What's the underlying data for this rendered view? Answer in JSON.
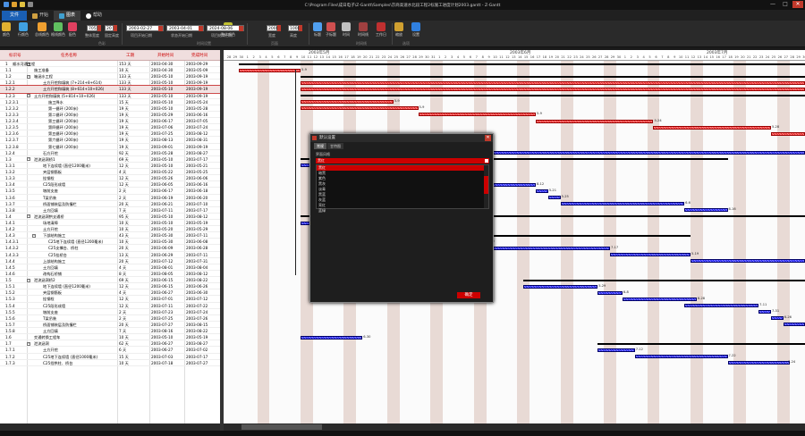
{
  "window": {
    "title": "C:\\Program Files\\成日电子\\Z-Gantt\\Samples\\京商高速水北段工程2标施工进度计划2003.gantt - Z-Gantt",
    "controls": {
      "minimize": "—",
      "maximize": "□",
      "close": "✕"
    }
  },
  "tabs": {
    "file": "文件",
    "start": "开始",
    "view": "图表",
    "help": "帮助"
  },
  "ribbon": {
    "buttons": [
      {
        "label": "颜色",
        "color": "#e0b030"
      },
      {
        "label": "行颜色",
        "color": "#40a0e0"
      },
      {
        "label": "总线颜色",
        "color": "#f0a030"
      },
      {
        "label": "格线颜色",
        "color": "#60c060"
      },
      {
        "label": "配色",
        "color": "#e04060"
      },
      {
        "label": "整体颜色",
        "color": "#c0c030"
      },
      {
        "label": "标题",
        "color": "#50a0f0"
      },
      {
        "label": "子标题",
        "color": "#d05050"
      },
      {
        "label": "时间",
        "color": "#c0c0c0"
      },
      {
        "label": "时间线",
        "color": "#a04040"
      },
      {
        "label": "工作日",
        "color": "#c03030"
      },
      {
        "label": "缩放",
        "color": "#d0a030"
      },
      {
        "label": "设置",
        "color": "#3080e0"
      }
    ],
    "zoom_value": "705",
    "zoom_label": "整体宽度",
    "row_height_value": "20",
    "row_height_label": "固定高度",
    "date_start": "2003-02-27",
    "date_start_label": "项目开始日期",
    "date_status": "2003-04-01",
    "date_status_label": "状态开始日期",
    "date_end": "2024-08-06",
    "date_end_label": "项目结束日期",
    "width_value": "2000",
    "width_label": "宽度",
    "height_value": "1000",
    "height_label": "高度",
    "groups": {
      "color": "色彩",
      "time": "时间设置",
      "page": "页面",
      "timeline": "时间线",
      "setup": "选项"
    }
  },
  "grid": {
    "headers": {
      "id": "标识号",
      "name": "任务名称",
      "duration": "工期",
      "start": "开始时间",
      "finish": "完成时间"
    },
    "rows": [
      {
        "id": "1",
        "indent": 0,
        "toggle": "−",
        "name": "顺水河通工程",
        "duration": "153 天",
        "start": "2003-04-30",
        "finish": "2003-09-29"
      },
      {
        "id": "1.1",
        "indent": 1,
        "name": "施工准备",
        "duration": "10 天",
        "start": "2003-04-30",
        "finish": "2003-05-09"
      },
      {
        "id": "1.2",
        "indent": 1,
        "toggle": "−",
        "name": "箱涵水工程",
        "duration": "133 天",
        "start": "2003-05-10",
        "finish": "2003-09-19"
      },
      {
        "id": "1.2.1",
        "indent": 2,
        "name": "土方开挖和填筑 (7+214+8+614)",
        "duration": "133 天",
        "start": "2003-05-10",
        "finish": "2003-09-19"
      },
      {
        "id": "1.2.2",
        "indent": 2,
        "name": "土方开挖和填筑 (8+614+10+026)",
        "duration": "133 天",
        "start": "2003-05-10",
        "finish": "2003-09-19",
        "selected": true
      },
      {
        "id": "1.2.3",
        "indent": 1,
        "toggle": "−",
        "name": "土方开挖和填筑 (5+814+10+026)",
        "duration": "133 天",
        "start": "2003-05-10",
        "finish": "2003-09-19"
      },
      {
        "id": "1.2.3.1",
        "indent": 3,
        "name": "施工降水",
        "duration": "15 天",
        "start": "2003-05-10",
        "finish": "2003-05-24"
      },
      {
        "id": "1.2.3.2",
        "indent": 3,
        "name": "第一循环 (200米)",
        "duration": "19 天",
        "start": "2003-05-10",
        "finish": "2003-05-28"
      },
      {
        "id": "1.2.3.3",
        "indent": 3,
        "name": "第二循环 (200米)",
        "duration": "19 天",
        "start": "2003-05-29",
        "finish": "2003-06-16"
      },
      {
        "id": "1.2.3.4",
        "indent": 3,
        "name": "第三循环 (200米)",
        "duration": "19 天",
        "start": "2003-06-17",
        "finish": "2003-07-05"
      },
      {
        "id": "1.2.3.5",
        "indent": 3,
        "name": "第四循环 (200米)",
        "duration": "19 天",
        "start": "2003-07-06",
        "finish": "2003-07-24"
      },
      {
        "id": "1.2.3.6",
        "indent": 3,
        "name": "第五循环 (200米)",
        "duration": "19 天",
        "start": "2003-07-25",
        "finish": "2003-08-12"
      },
      {
        "id": "1.2.3.7",
        "indent": 3,
        "name": "第六循环 (200米)",
        "duration": "19 天",
        "start": "2003-08-13",
        "finish": "2003-08-31"
      },
      {
        "id": "1.2.3.8",
        "indent": 3,
        "name": "第七循环 (200米)",
        "duration": "19 天",
        "start": "2003-09-01",
        "finish": "2003-09-19"
      },
      {
        "id": "1.2.4",
        "indent": 2,
        "name": "石方开挖",
        "duration": "92 天",
        "start": "2003-05-28",
        "finish": "2003-08-27"
      },
      {
        "id": "1.3",
        "indent": 1,
        "toggle": "−",
        "name": "泄流涵洞桥1",
        "duration": "69 天",
        "start": "2003-05-10",
        "finish": "2003-07-17"
      },
      {
        "id": "1.3.1",
        "indent": 2,
        "name": "地下连续墙 (直径1200毫米)",
        "duration": "12 天",
        "start": "2003-05-10",
        "finish": "2003-05-21"
      },
      {
        "id": "1.3.2",
        "indent": 2,
        "name": "夹层钢筋板",
        "duration": "4 天",
        "start": "2003-05-22",
        "finish": "2003-05-25"
      },
      {
        "id": "1.3.3",
        "indent": 2,
        "name": "挂钢栓",
        "duration": "12 天",
        "start": "2003-05-26",
        "finish": "2003-06-06"
      },
      {
        "id": "1.3.4",
        "indent": 2,
        "name": "C25段形成墙",
        "duration": "12 天",
        "start": "2003-06-05",
        "finish": "2003-06-16"
      },
      {
        "id": "1.3.5",
        "indent": 2,
        "name": "墩前支座",
        "duration": "2 天",
        "start": "2003-06-17",
        "finish": "2003-06-18"
      },
      {
        "id": "1.3.6",
        "indent": 2,
        "name": "T梁吊装",
        "duration": "2 天",
        "start": "2003-06-19",
        "finish": "2003-06-20"
      },
      {
        "id": "1.3.7",
        "indent": 2,
        "name": "桥面铺装层及防撞栏",
        "duration": "20 天",
        "start": "2003-06-21",
        "finish": "2003-07-10"
      },
      {
        "id": "1.3.8",
        "indent": 2,
        "name": "土方回填",
        "duration": "7 天",
        "start": "2003-07-11",
        "finish": "2003-07-17"
      },
      {
        "id": "1.4",
        "indent": 1,
        "toggle": "−",
        "name": "泄流涵洞拱支通桥",
        "duration": "95 天",
        "start": "2003-05-10",
        "finish": "2003-08-12"
      },
      {
        "id": "1.4.1",
        "indent": 2,
        "name": "场地清障",
        "duration": "10 天",
        "start": "2003-05-10",
        "finish": "2003-05-19"
      },
      {
        "id": "1.4.2",
        "indent": 2,
        "name": "土方开挖",
        "duration": "10 天",
        "start": "2003-05-20",
        "finish": "2003-05-29"
      },
      {
        "id": "1.4.3",
        "indent": 2,
        "toggle": "−",
        "name": "下部结构施工",
        "duration": "43 天",
        "start": "2003-05-30",
        "finish": "2003-07-11"
      },
      {
        "id": "1.4.3.1",
        "indent": 3,
        "name": "C25地下连续墙 (直径1200毫米)",
        "duration": "10 天",
        "start": "2003-05-30",
        "finish": "2003-06-08"
      },
      {
        "id": "1.4.3.2",
        "indent": 3,
        "name": "C25支撑台、桥柱",
        "duration": "20 天",
        "start": "2003-06-09",
        "finish": "2003-06-28"
      },
      {
        "id": "1.4.3.3",
        "indent": 3,
        "name": "C25挂桥台",
        "duration": "13 天",
        "start": "2003-06-29",
        "finish": "2003-07-11"
      },
      {
        "id": "1.4.4",
        "indent": 2,
        "name": "上部结构施工",
        "duration": "20 天",
        "start": "2003-07-12",
        "finish": "2003-07-31"
      },
      {
        "id": "1.4.5",
        "indent": 2,
        "name": "土方回填",
        "duration": "4 天",
        "start": "2003-08-01",
        "finish": "2003-08-04"
      },
      {
        "id": "1.4.6",
        "indent": 2,
        "name": "改构石桥铺",
        "duration": "8 天",
        "start": "2003-08-05",
        "finish": "2003-08-12"
      },
      {
        "id": "1.5",
        "indent": 1,
        "toggle": "−",
        "name": "泄流涵洞桥2",
        "duration": "69 天",
        "start": "2003-06-15",
        "finish": "2003-08-22"
      },
      {
        "id": "1.5.1",
        "indent": 2,
        "name": "地下连续墙 (直径1200毫米)",
        "duration": "12 天",
        "start": "2003-06-15",
        "finish": "2003-06-26"
      },
      {
        "id": "1.5.2",
        "indent": 2,
        "name": "夹层钢筋板",
        "duration": "4 天",
        "start": "2003-06-27",
        "finish": "2003-06-30"
      },
      {
        "id": "1.5.3",
        "indent": 2,
        "name": "挂钢栓",
        "duration": "12 天",
        "start": "2003-07-01",
        "finish": "2003-07-12"
      },
      {
        "id": "1.5.4",
        "indent": 2,
        "name": "C25段形成墙",
        "duration": "12 天",
        "start": "2003-07-11",
        "finish": "2003-07-22"
      },
      {
        "id": "1.5.5",
        "indent": 2,
        "name": "墩前支座",
        "duration": "2 天",
        "start": "2003-07-23",
        "finish": "2003-07-24"
      },
      {
        "id": "1.5.6",
        "indent": 2,
        "name": "T梁吊装",
        "duration": "2 天",
        "start": "2003-07-25",
        "finish": "2003-07-26"
      },
      {
        "id": "1.5.7",
        "indent": 2,
        "name": "桥面铺装层及防撞栏",
        "duration": "20 天",
        "start": "2003-07-27",
        "finish": "2003-08-15"
      },
      {
        "id": "1.5.8",
        "indent": 2,
        "name": "土方回填",
        "duration": "7 天",
        "start": "2003-08-16",
        "finish": "2003-08-22"
      },
      {
        "id": "1.6",
        "indent": 1,
        "name": "交通转换工程车",
        "duration": "10 天",
        "start": "2003-05-10",
        "finish": "2003-05-19"
      },
      {
        "id": "1.7",
        "indent": 1,
        "toggle": "−",
        "name": "泄流涵洞",
        "duration": "62 天",
        "start": "2003-06-27",
        "finish": "2003-08-27"
      },
      {
        "id": "1.7.1",
        "indent": 2,
        "name": "土方开挖",
        "duration": "6 天",
        "start": "2003-06-27",
        "finish": "2003-07-02"
      },
      {
        "id": "1.7.2",
        "indent": 2,
        "name": "C25地下连续墙 (直径1000毫米)",
        "duration": "15 天",
        "start": "2003-07-03",
        "finish": "2003-07-17"
      },
      {
        "id": "1.7.3",
        "indent": 2,
        "name": "C25挡拱柱、桥台",
        "duration": "10 天",
        "start": "2003-07-18",
        "finish": "2003-07-27"
      }
    ]
  },
  "gantt": {
    "months": [
      "2003年5月",
      "2003年6月",
      "2003年7月"
    ],
    "days": [
      "28",
      "29",
      "30",
      "1",
      "2",
      "3",
      "4",
      "5",
      "6",
      "7",
      "8",
      "9",
      "10",
      "11",
      "12",
      "13",
      "14",
      "15",
      "16",
      "17",
      "18",
      "19",
      "20",
      "21",
      "22",
      "23",
      "24",
      "25",
      "26",
      "27",
      "28",
      "29",
      "30",
      "31",
      "1",
      "2",
      "3",
      "4",
      "5",
      "6",
      "7",
      "8",
      "9",
      "10",
      "11",
      "12",
      "13",
      "14",
      "15",
      "16",
      "17",
      "18",
      "19",
      "20",
      "21",
      "22",
      "23",
      "24",
      "25",
      "26",
      "27",
      "28",
      "29",
      "30",
      "1",
      "2",
      "3",
      "4",
      "5",
      "6",
      "7",
      "8",
      "9",
      "10",
      "11",
      "12",
      "13",
      "14",
      "15",
      "16",
      "17",
      "18",
      "19",
      "20",
      "21",
      "22",
      "23",
      "24",
      "25",
      "26",
      "27",
      "28",
      "29",
      "30",
      "31"
    ],
    "bar_labels": [
      "5-9",
      "5-9",
      "5-9",
      "5-9",
      "5-24",
      "5-28",
      "6-16",
      "7-5",
      "7-24",
      "8-12",
      "5-21",
      "5-25",
      "6-6",
      "6-16",
      "6-18",
      "6-20",
      "7-10",
      "7-17",
      "5-19",
      "5-29",
      "6-8",
      "6-28",
      "7-11",
      "7-31",
      "6-26",
      "6-30",
      "7-12",
      "7-22",
      "7-24",
      "7-26",
      "8-15",
      "8-22",
      "7-2",
      "7-17",
      "7-27"
    ],
    "colors": {
      "critical": "#e53935",
      "normal": "#2a2aff",
      "weekend": "#e8dad5"
    }
  },
  "dialog": {
    "title": "默认设置",
    "tabs": [
      "常规",
      "甘特图"
    ],
    "label": "界面风格",
    "selected": "黑红",
    "options": [
      "黑红",
      "暗黑",
      "紫色",
      "黑灰",
      "淡青",
      "黑蓝",
      "灰蓝",
      "亮红",
      "蓝绿"
    ],
    "ok": "确定"
  }
}
